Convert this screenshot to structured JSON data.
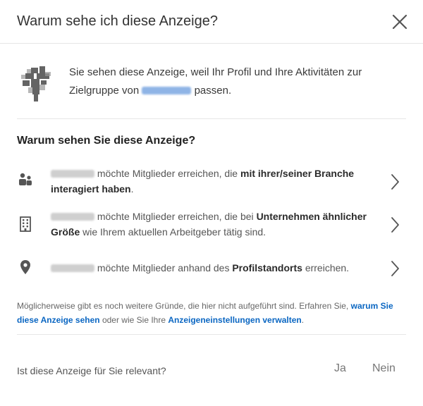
{
  "header": {
    "title": "Warum sehe ich diese Anzeige?"
  },
  "intro": {
    "text_before": "Sie sehen diese Anzeige, weil Ihr Profil und Ihre Aktivitäten zur Zielgruppe von",
    "text_after": "passen."
  },
  "section": {
    "title": "Warum sehen Sie diese Anzeige?"
  },
  "reasons": [
    {
      "icon": "people-icon",
      "text_a": "möchte Mitglieder erreichen, die",
      "text_bold": "mit ihrer/seiner Branche interagiert haben",
      "text_b": "."
    },
    {
      "icon": "building-icon",
      "text_a": "möchte Mitglieder erreichen, die bei",
      "text_bold": "Unternehmen ähnlicher Größe",
      "text_b": "wie Ihrem aktuellen Arbeitgeber tätig sind."
    },
    {
      "icon": "location-pin-icon",
      "text_a": "möchte Mitglieder anhand des",
      "text_bold": "Profilstandorts",
      "text_b": "erreichen."
    }
  ],
  "footnote": {
    "text_a": "Möglicherweise gibt es noch weitere Gründe, die hier nicht aufgeführt sind. Erfahren Sie,",
    "link1": "warum Sie diese Anzeige sehen",
    "text_b": "oder wie Sie Ihre",
    "link2": "Anzeigeneinstellungen verwalten",
    "text_c": "."
  },
  "feedback": {
    "question": "Ist diese Anzeige für Sie relevant?",
    "yes": "Ja",
    "no": "Nein"
  },
  "colors": {
    "link": "#0a66c2",
    "redacted_blue": "#8fb4e6",
    "redacted_gray": "#cfcfcf"
  }
}
